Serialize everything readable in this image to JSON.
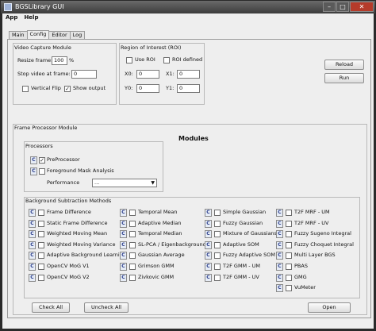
{
  "window": {
    "title": "BGSLibrary GUI",
    "minimize": "–",
    "maximize": "□",
    "close": "✕"
  },
  "menu": [
    "App",
    "Help"
  ],
  "tabs": [
    "Main",
    "Config",
    "Editor",
    "Log"
  ],
  "video_capture": {
    "title": "Video Capture Module",
    "resize_label": "Resize frame:",
    "resize_value": "100",
    "resize_unit": "%",
    "stop_label": "Stop video at frame:",
    "stop_value": "0",
    "vertical_flip": "Vertical Flip",
    "show_output": "Show output"
  },
  "roi": {
    "title": "Region of Interest (ROI)",
    "use_roi": "Use ROI",
    "roi_defined": "ROI defined",
    "x0_label": "X0:",
    "x0_value": "0",
    "x1_label": "X1:",
    "x1_value": "0",
    "y0_label": "Y0:",
    "y0_value": "0",
    "y1_label": "Y1:",
    "y1_value": "0"
  },
  "buttons": {
    "reload": "Reload",
    "run": "Run",
    "check_all": "Check All",
    "uncheck_all": "Uncheck All",
    "open": "Open"
  },
  "frame_processor": {
    "title": "Frame Processor Module",
    "modules_title": "Modules",
    "processors_title": "Processors",
    "preprocessor": "PreProcessor",
    "foreground_mask": "Foreground Mask Analysis",
    "performance_label": "Performance",
    "performance_value": "..."
  },
  "bgs": {
    "title": "Background Subtraction Methods",
    "c_label": "C",
    "check_mark": "✓",
    "columns": [
      [
        "Frame Difference",
        "Static Frame Difference",
        "Weighted Moving Mean",
        "Weighted Moving Variance",
        "Adaptive Background Learning",
        "OpenCV MoG V1",
        "OpenCV MoG V2"
      ],
      [
        "Temporal Mean",
        "Adaptive Median",
        "Temporal Median",
        "SL-PCA / Eigenbackground",
        "Gaussian Average",
        "Grimson GMM",
        "Zivkovic GMM"
      ],
      [
        "Simple Gaussian",
        "Fuzzy Gaussian",
        "Mixture of Gaussians",
        "Adaptive SOM",
        "Fuzzy Adaptive SOM",
        "T2F GMM - UM",
        "T2F GMM - UV"
      ],
      [
        "T2F MRF - UM",
        "T2F MRF - UV",
        "Fuzzy Sugeno Integral",
        "Fuzzy Choquet Integral",
        "Multi Layer BGS",
        "PBAS",
        "GMG",
        "VuMeter"
      ]
    ]
  }
}
